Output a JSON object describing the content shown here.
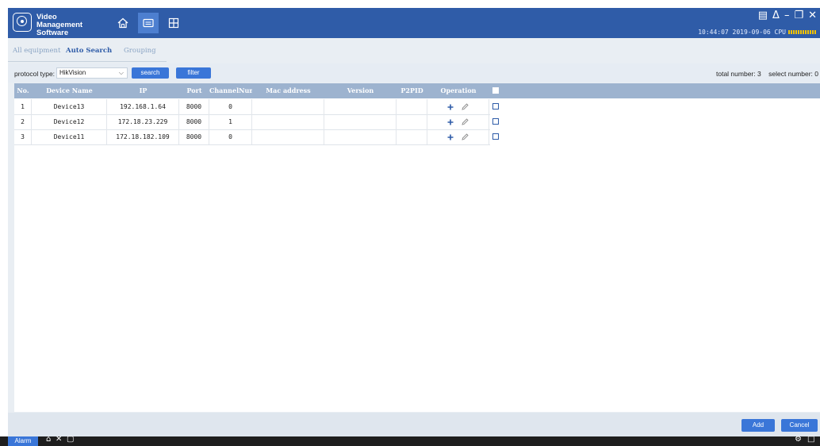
{
  "titlebar": {
    "app_title": "Video Management Software",
    "nav": [
      {
        "name": "home-icon"
      },
      {
        "name": "device-manager-icon",
        "active": true
      },
      {
        "name": "grid-view-icon"
      }
    ],
    "window_controls": [
      "screen-icon",
      "user-icon",
      "minimize-icon",
      "restore-icon",
      "close-icon"
    ],
    "datetime": "10:44:07 2019-09-06",
    "cpu_label": "CPU"
  },
  "tabs": [
    {
      "label": "All equipment",
      "active": false
    },
    {
      "label": "Auto Search",
      "active": true
    },
    {
      "label": "Grouping",
      "active": false
    }
  ],
  "toolbar": {
    "protocol_label": "protocol type:",
    "protocol_value": "HikVision",
    "search_label": "search",
    "filter_label": "filter",
    "total_number_text": "total number: 3",
    "select_number_text": "select number: 0"
  },
  "table": {
    "columns": [
      "No.",
      "Device Name",
      "IP",
      "Port",
      "ChannelNum",
      "Mac address",
      "Version",
      "P2PID",
      "Operation"
    ],
    "rows": [
      {
        "no": "1",
        "name": "Device13",
        "ip": "192.168.1.64",
        "port": "8000",
        "channels": "0",
        "mac": "",
        "version": "",
        "p2pid": ""
      },
      {
        "no": "2",
        "name": "Device12",
        "ip": "172.18.23.229",
        "port": "8000",
        "channels": "1",
        "mac": "",
        "version": "",
        "p2pid": ""
      },
      {
        "no": "3",
        "name": "Device11",
        "ip": "172.18.182.109",
        "port": "8000",
        "channels": "0",
        "mac": "",
        "version": "",
        "p2pid": ""
      }
    ]
  },
  "footer": {
    "add_label": "Add",
    "cancel_label": "Cancel"
  },
  "statusbar": {
    "alarm_label": "Alarm"
  },
  "colors": {
    "titlebar": "#2f5ca8",
    "accent": "#3a76d8",
    "table_header": "#9db3cf"
  }
}
